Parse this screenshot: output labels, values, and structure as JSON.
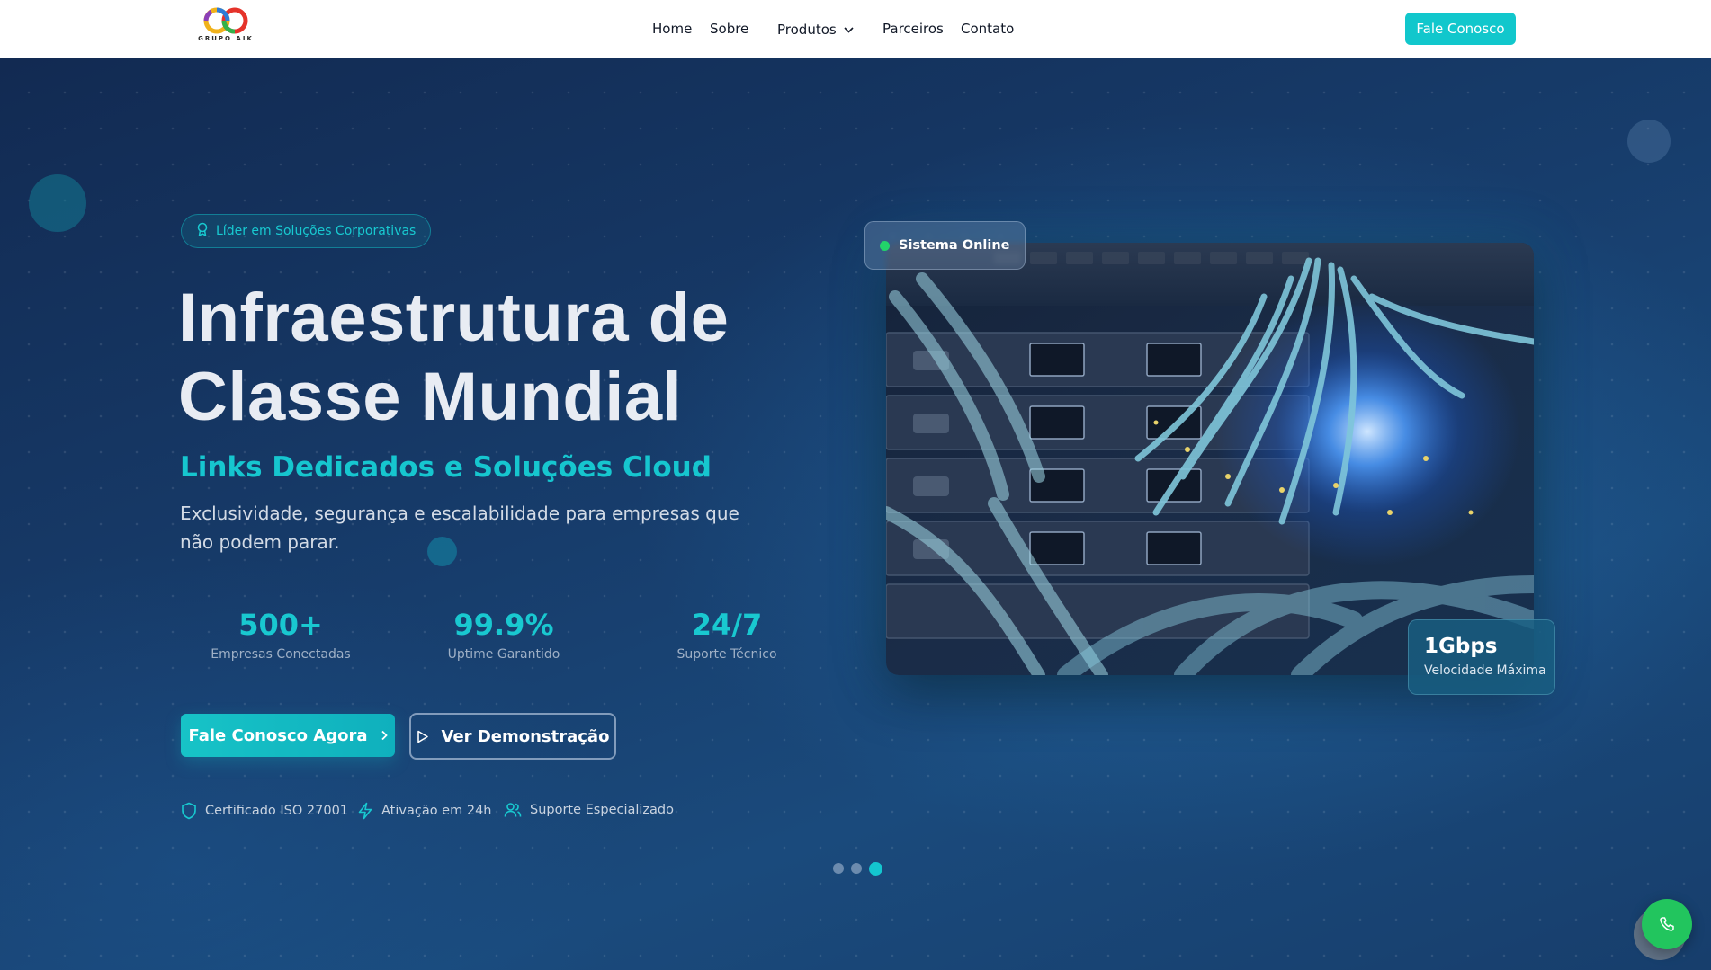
{
  "nav": {
    "logo_text": "GRUPO AIK",
    "links": [
      "Home",
      "Sobre",
      "Produtos",
      "Parceiros",
      "Contato"
    ],
    "cta": "Fale Conosco"
  },
  "hero": {
    "badge": "Líder em Soluções Corporativas",
    "title_line1": "Infraestrutura de",
    "title_line2": "Classe Mundial",
    "subtitle": "Links Dedicados e Soluções Cloud",
    "description": "Exclusividade, segurança e escalabilidade para empresas que não podem parar.",
    "stats": [
      {
        "value": "500+",
        "label": "Empresas Conectadas"
      },
      {
        "value": "99.9%",
        "label": "Uptime Garantido"
      },
      {
        "value": "24/7",
        "label": "Suporte Técnico"
      }
    ],
    "primary_button": "Fale Conosco Agora",
    "secondary_button": "Ver Demonstração",
    "features": [
      {
        "icon": "shield-icon",
        "label": "Certificado ISO 27001"
      },
      {
        "icon": "lightning-icon",
        "label": "Ativação em 24h"
      },
      {
        "icon": "users-icon",
        "label": "Suporte Especializado"
      }
    ],
    "carousel": {
      "count": 3,
      "active_index": 2
    }
  },
  "card": {
    "status": "Sistema Online",
    "speed_value": "1Gbps",
    "speed_label": "Velocidade Máxima"
  },
  "colors": {
    "accent": "#11c7cc",
    "navy": "#163a66",
    "online": "#22d36a",
    "whatsapp": "#22c55e"
  }
}
